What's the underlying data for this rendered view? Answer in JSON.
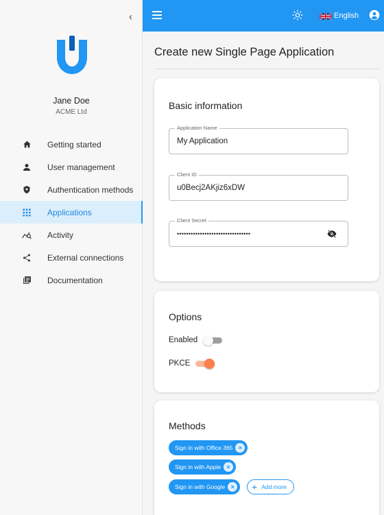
{
  "sidebar": {
    "user_name": "Jane Doe",
    "user_org": "ACME Ltd",
    "items": [
      {
        "label": "Getting started",
        "icon": "home-icon"
      },
      {
        "label": "User management",
        "icon": "person-icon"
      },
      {
        "label": "Authentication methods",
        "icon": "shield-icon"
      },
      {
        "label": "Applications",
        "icon": "grid-icon",
        "active": true
      },
      {
        "label": "Activity",
        "icon": "activity-icon"
      },
      {
        "label": "External connections",
        "icon": "share-icon"
      },
      {
        "label": "Documentation",
        "icon": "library-icon"
      }
    ]
  },
  "topbar": {
    "language": "English"
  },
  "page": {
    "title": "Create new Single Page Application"
  },
  "basic": {
    "title": "Basic information",
    "app_name_label": "Application Name",
    "app_name_value": "My Application",
    "client_id_label": "Client ID",
    "client_id_value": "u0Becj2AKjiz6xDW",
    "client_secret_label": "Client Secret",
    "client_secret_value": "••••••••••••••••••••••••••••••••"
  },
  "options": {
    "title": "Options",
    "enabled_label": "Enabled",
    "enabled": false,
    "pkce_label": "PKCE",
    "pkce": true
  },
  "methods": {
    "title": "Methods",
    "chips": [
      "Sign in with Office 365",
      "Sign in with Apple",
      "Sign in with Google"
    ],
    "add_more_label": "Add more"
  },
  "colors": {
    "primary": "#2196f3",
    "accent": "#fb7f4b"
  }
}
